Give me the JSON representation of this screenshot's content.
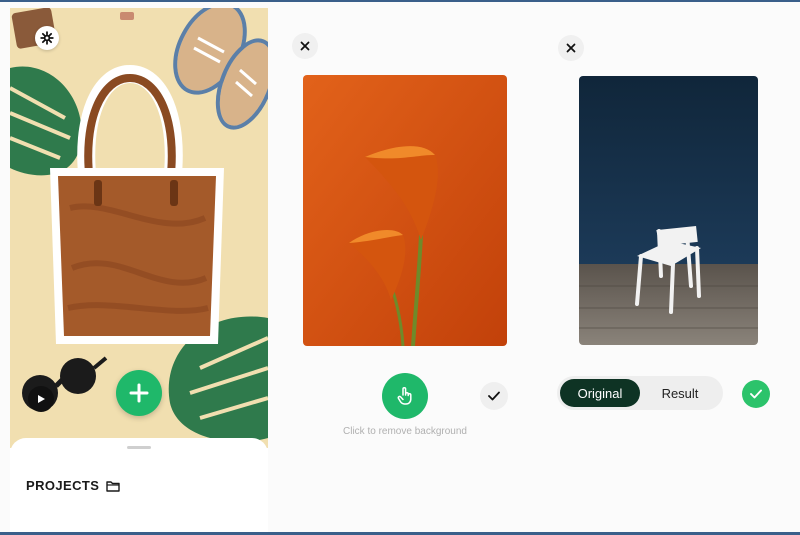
{
  "editor": {
    "projects_label": "PROJECTS",
    "accent_color": "#1fb86a"
  },
  "remove_step": {
    "hint": "Click to remove background"
  },
  "compare_step": {
    "toggle_options": [
      "Original",
      "Result"
    ],
    "selected": "Original",
    "toggle_active_color": "#0e3324"
  },
  "icons": [
    "gear-icon",
    "plus-icon",
    "play-icon",
    "folder-icon",
    "close-icon",
    "tap-hand-icon",
    "check-icon"
  ]
}
